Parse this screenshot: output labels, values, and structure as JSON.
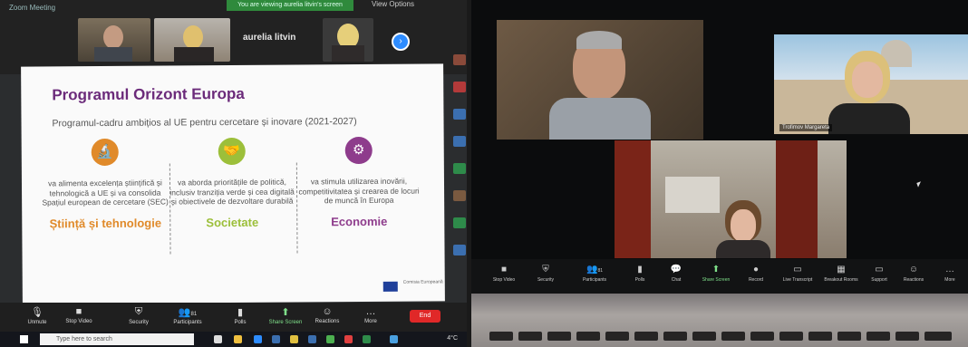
{
  "left": {
    "zoom_header": {
      "title": "Zoom Meeting",
      "green_banner": "You are viewing aurelia litvin's screen",
      "view_options": "View Options"
    },
    "participant_name": "aurelia litvin",
    "slide": {
      "title": "Programul Orizont Europa",
      "subtitle": "Programul-cadru ambițios al UE pentru cercetare și inovare (2021-2027)",
      "pillars": [
        {
          "icon": "microscope-icon",
          "color": "#e08a2a",
          "text": "va alimenta excelența științifică și tehnologică a UE și va consolida Spațiul european de cercetare (SEC)",
          "title": "Știință și tehnologie"
        },
        {
          "icon": "handshake-icon",
          "color": "#9cbf3a",
          "text": "va aborda prioritățile de politică, inclusiv tranziția verde și cea digitală și obiectivele de dezvoltare durabilă",
          "title": "Societate"
        },
        {
          "icon": "gears-icon",
          "color": "#8e3c8c",
          "text": "va stimula utilizarea inovării, competitivitatea și crearea de locuri de muncă în Europa",
          "title": "Economie"
        }
      ],
      "footer": "Comisia Europeană"
    },
    "controls": [
      "Unmute",
      "Stop Video",
      "Security",
      "Participants",
      "Polls",
      "Share Screen",
      "Reactions",
      "More"
    ],
    "participants_count": "81",
    "end_label": "End",
    "taskbar": {
      "search_placeholder": "Type here to search",
      "weather": "4°C"
    }
  },
  "right": {
    "tile_label": "Trofimov Margareta",
    "controls": [
      "Stop Video",
      "Security",
      "Participants",
      "Polls",
      "Chat",
      "Share Screen",
      "Record",
      "Live Transcript",
      "Breakout Rooms",
      "Support",
      "Reactions",
      "More"
    ],
    "participants_count": "81"
  }
}
